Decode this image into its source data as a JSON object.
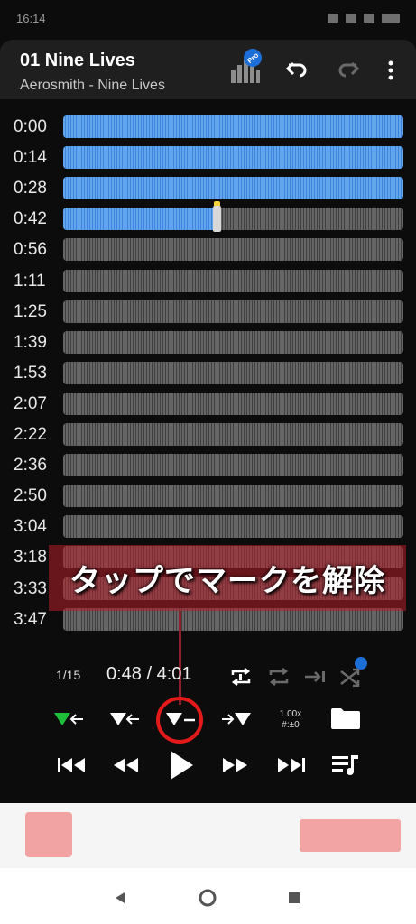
{
  "status": {
    "time": "16:14"
  },
  "header": {
    "title": "01 Nine Lives",
    "subtitle": "Aerosmith - Nine Lives",
    "pro_badge": "Pro"
  },
  "waveform": {
    "rows": [
      {
        "time": "0:00",
        "state": "played"
      },
      {
        "time": "0:14",
        "state": "played"
      },
      {
        "time": "0:28",
        "state": "played"
      },
      {
        "time": "0:42",
        "state": "partial",
        "fill": 0.45
      },
      {
        "time": "0:56",
        "state": "unplayed"
      },
      {
        "time": "1:11",
        "state": "unplayed"
      },
      {
        "time": "1:25",
        "state": "unplayed"
      },
      {
        "time": "1:39",
        "state": "unplayed"
      },
      {
        "time": "1:53",
        "state": "unplayed"
      },
      {
        "time": "2:07",
        "state": "unplayed"
      },
      {
        "time": "2:22",
        "state": "unplayed"
      },
      {
        "time": "2:36",
        "state": "unplayed"
      },
      {
        "time": "2:50",
        "state": "unplayed"
      },
      {
        "time": "3:04",
        "state": "unplayed"
      },
      {
        "time": "3:18",
        "state": "marked"
      },
      {
        "time": "3:33",
        "state": "marked"
      },
      {
        "time": "3:47",
        "state": "marked"
      }
    ]
  },
  "annotation": {
    "text": "タップでマークを解除"
  },
  "info": {
    "track_index": "1/15",
    "position": "0:48 / 4:01"
  },
  "speed": {
    "rate": "1.00x",
    "pitch": "#:±0"
  },
  "colors": {
    "played": "#3b85db",
    "mark_green": "#1fbf3a",
    "annotation_red": "#e21a1a"
  }
}
